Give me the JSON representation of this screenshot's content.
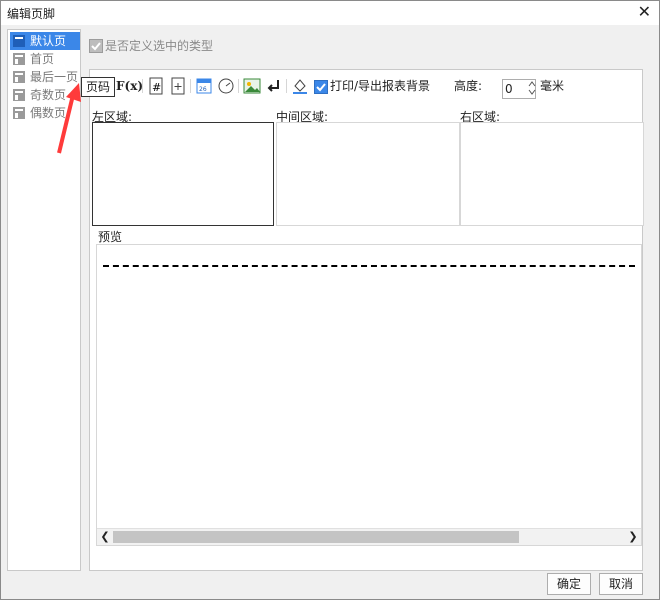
{
  "window": {
    "title": "编辑页脚"
  },
  "sidebar": {
    "items": [
      {
        "label": "默认页",
        "active": true
      },
      {
        "label": "首页",
        "active": false
      },
      {
        "label": "最后一页",
        "active": false
      },
      {
        "label": "奇数页",
        "active": false
      },
      {
        "label": "偶数页",
        "active": false
      }
    ]
  },
  "main": {
    "custom_type_label": "是否定义选中的类型",
    "toolbar": {
      "text_label": "ab",
      "formula_label": "F(x)",
      "print_bg_label": "打印/导出报表背景",
      "height_label": "高度:",
      "height_value": "0",
      "unit_label": "毫米"
    },
    "tooltip": "页码",
    "regions": {
      "left": "左区域:",
      "center": "中间区域:",
      "right": "右区域:"
    },
    "preview_label": "预览"
  },
  "footer": {
    "ok_label": "确定",
    "cancel_label": "取消"
  }
}
